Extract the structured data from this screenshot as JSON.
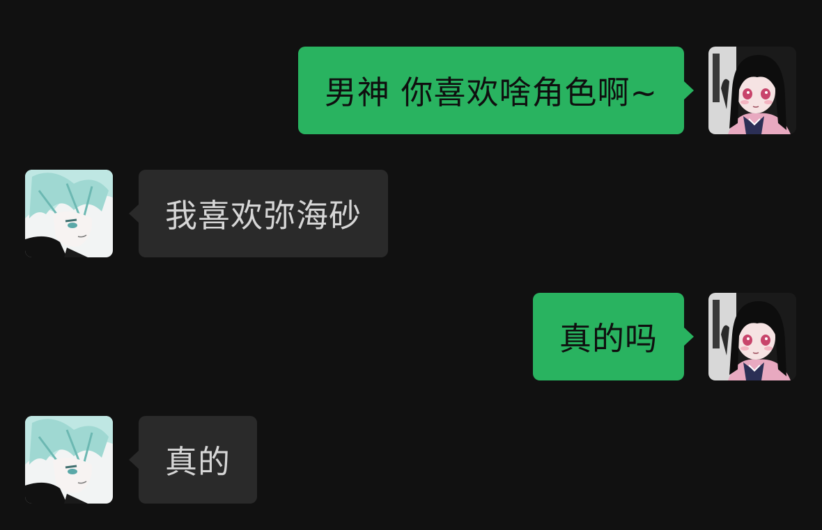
{
  "colors": {
    "background": "#111111",
    "outgoing_bubble": "#29b360",
    "incoming_bubble": "#2a2a2a",
    "outgoing_text": "#0f0f0f",
    "incoming_text": "#d6d6d6"
  },
  "messages": [
    {
      "side": "right",
      "sender": "self",
      "avatar_icon": "anime-girl-avatar-icon",
      "text": "男神 你喜欢啥角色啊~"
    },
    {
      "side": "left",
      "sender": "other",
      "avatar_icon": "anime-boy-avatar-icon",
      "text": "我喜欢弥海砂"
    },
    {
      "side": "right",
      "sender": "self",
      "avatar_icon": "anime-girl-avatar-icon",
      "text": "真的吗"
    },
    {
      "side": "left",
      "sender": "other",
      "avatar_icon": "anime-boy-avatar-icon",
      "text": "真的"
    }
  ]
}
